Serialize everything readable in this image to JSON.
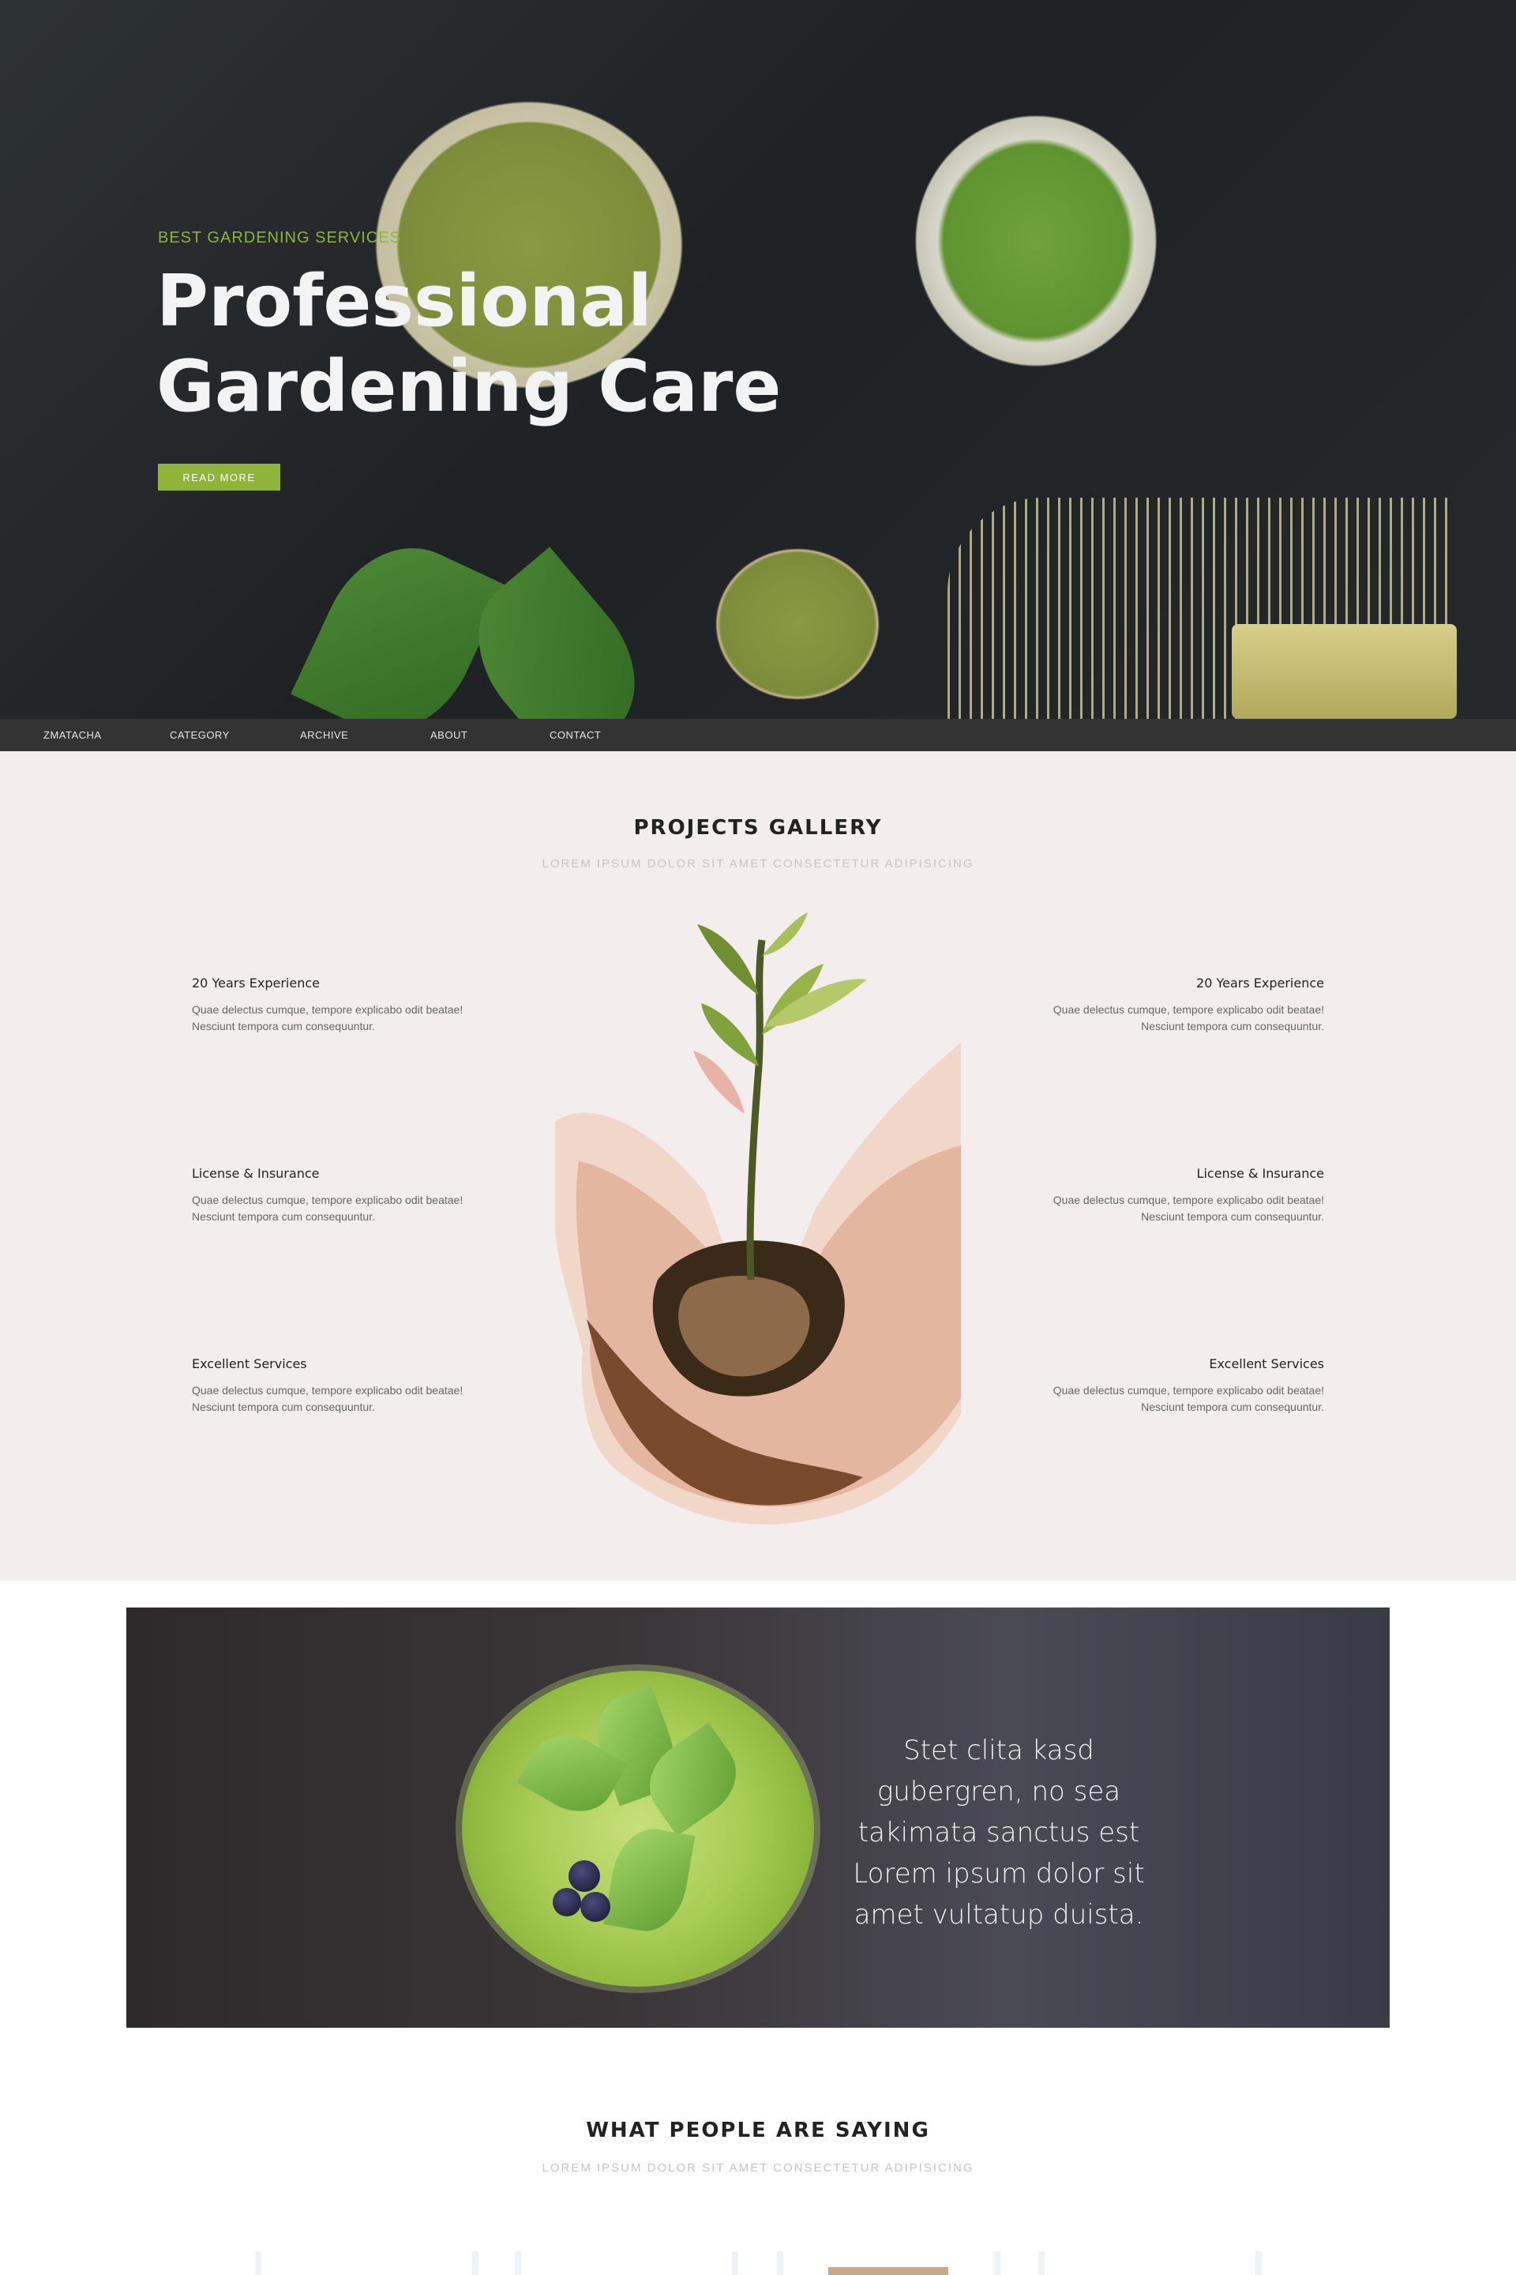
{
  "hero": {
    "kicker": "BEST GARDENING SERVICES",
    "title": "Professional Gardening Care",
    "button_label": "READ MORE"
  },
  "nav": {
    "items": [
      "ZMATACHA",
      "CATEGORY",
      "ARCHIVE",
      "ABOUT",
      "CONTACT"
    ]
  },
  "gallery": {
    "title": "PROJECTS GALLERY",
    "subtitle": "LOREM IPSUM DOLOR SIT AMET CONSECTETUR ADIPISICING",
    "left_features": [
      {
        "title": "20 Years Experience",
        "text": "Quae delectus cumque, tempore explicabo odit beatae! Nesciunt tempora cum consequuntur."
      },
      {
        "title": "License & Insurance",
        "text": "Quae delectus cumque, tempore explicabo odit beatae! Nesciunt tempora cum consequuntur."
      },
      {
        "title": "Excellent Services",
        "text": "Quae delectus cumque, tempore explicabo odit beatae! Nesciunt tempora cum consequuntur."
      }
    ],
    "right_features": [
      {
        "title": "20 Years Experience",
        "text": "Quae delectus cumque, tempore explicabo odit beatae! Nesciunt tempora cum consequuntur."
      },
      {
        "title": "License & Insurance",
        "text": "Quae delectus cumque, tempore explicabo odit beatae! Nesciunt tempora cum consequuntur."
      },
      {
        "title": "Excellent Services",
        "text": "Quae delectus cumque, tempore explicabo odit beatae! Nesciunt tempora cum consequuntur."
      }
    ]
  },
  "banner": {
    "quote": "Stet clita kasd gubergren, no sea takimata sanctus est Lorem ipsum dolor sit amet vultatup duista."
  },
  "testimonials": {
    "title": "WHAT PEOPLE ARE SAYING",
    "subtitle": "LOREM IPSUM DOLOR SIT AMET CONSECTETUR ADIPISICING"
  },
  "colors": {
    "accent": "#8fb43a",
    "nav_bg": "#333333",
    "gallery_bg": "#f3eded"
  }
}
